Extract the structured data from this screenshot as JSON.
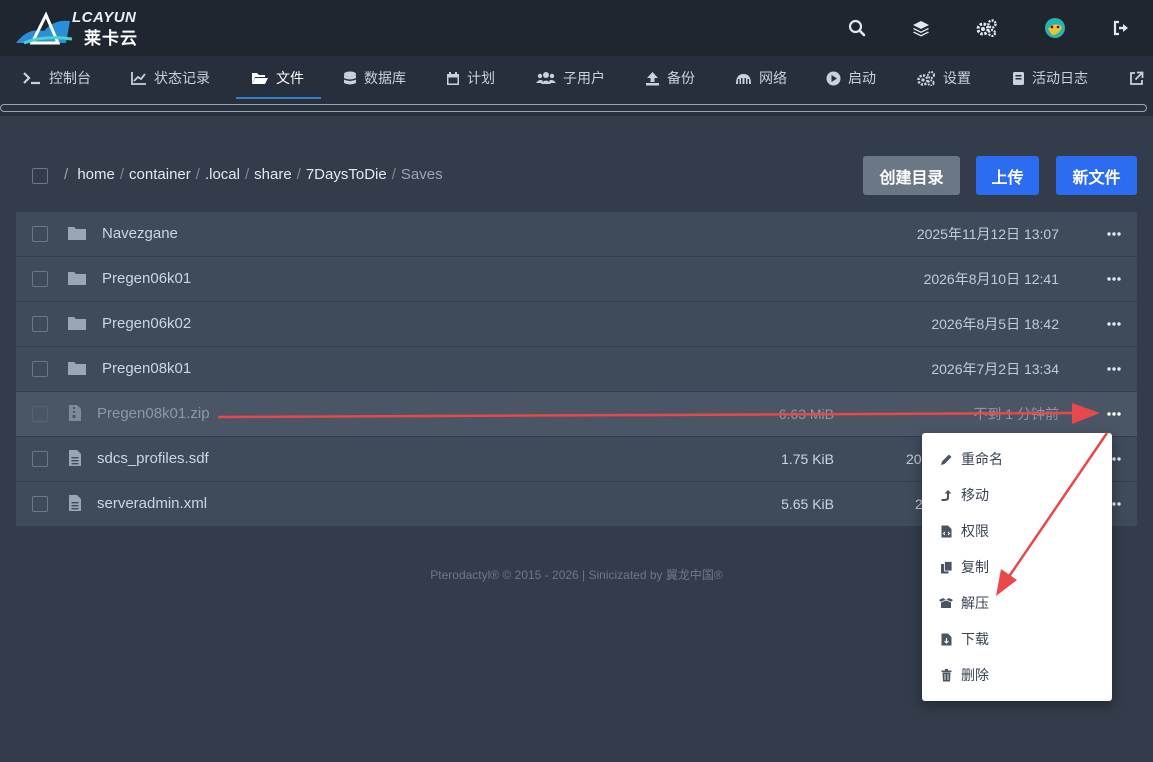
{
  "brand": {
    "name_en": "LCAYUN",
    "name_cn": "莱卡云"
  },
  "nav": [
    {
      "label": "控制台",
      "icon": "terminal-icon"
    },
    {
      "label": "状态记录",
      "icon": "chart-icon"
    },
    {
      "label": "文件",
      "icon": "folder-open-icon",
      "active": true
    },
    {
      "label": "数据库",
      "icon": "database-icon"
    },
    {
      "label": "计划",
      "icon": "calendar-icon"
    },
    {
      "label": "子用户",
      "icon": "users-icon"
    },
    {
      "label": "备份",
      "icon": "upload-icon"
    },
    {
      "label": "网络",
      "icon": "network-icon"
    },
    {
      "label": "启动",
      "icon": "play-icon"
    },
    {
      "label": "设置",
      "icon": "gears-icon"
    },
    {
      "label": "活动日志",
      "icon": "book-icon"
    }
  ],
  "breadcrumb": {
    "root": "/",
    "segments": [
      "home",
      "container",
      ".local",
      "share",
      "7DaysToDie"
    ],
    "current": "Saves"
  },
  "actions": {
    "create_dir": "创建目录",
    "upload": "上传",
    "new_file": "新文件"
  },
  "files": [
    {
      "name": "Navezgane",
      "type": "folder",
      "size": "",
      "date": "2025年11月12日 13:07"
    },
    {
      "name": "Pregen06k01",
      "type": "folder",
      "size": "",
      "date": "2026年8月10日 12:41"
    },
    {
      "name": "Pregen06k02",
      "type": "folder",
      "size": "",
      "date": "2026年8月5日 18:42"
    },
    {
      "name": "Pregen08k01",
      "type": "folder",
      "size": "",
      "date": "2026年7月2日 13:34"
    },
    {
      "name": "Pregen08k01.zip",
      "type": "archive",
      "size": "6.63 MiB",
      "date": "不到 1 分钟前"
    },
    {
      "name": "sdcs_profiles.sdf",
      "type": "file",
      "size": "1.75 KiB",
      "date": "20"
    },
    {
      "name": "serveradmin.xml",
      "type": "file",
      "size": "5.65 KiB",
      "date": "2"
    }
  ],
  "context_menu": [
    {
      "label": "重命名",
      "icon": "pencil-icon"
    },
    {
      "label": "移动",
      "icon": "move-icon"
    },
    {
      "label": "权限",
      "icon": "file-code-icon"
    },
    {
      "label": "复制",
      "icon": "copy-icon"
    },
    {
      "label": "解压",
      "icon": "box-open-icon"
    },
    {
      "label": "下载",
      "icon": "file-download-icon"
    },
    {
      "label": "删除",
      "icon": "trash-icon"
    }
  ],
  "footer": "Pterodactyl® © 2015 - 2026 | Sinicizated by 翼龙中国®",
  "colors": {
    "accent": "#2b6cf0",
    "annotation": "#e8474b",
    "background": "#323c4a"
  }
}
